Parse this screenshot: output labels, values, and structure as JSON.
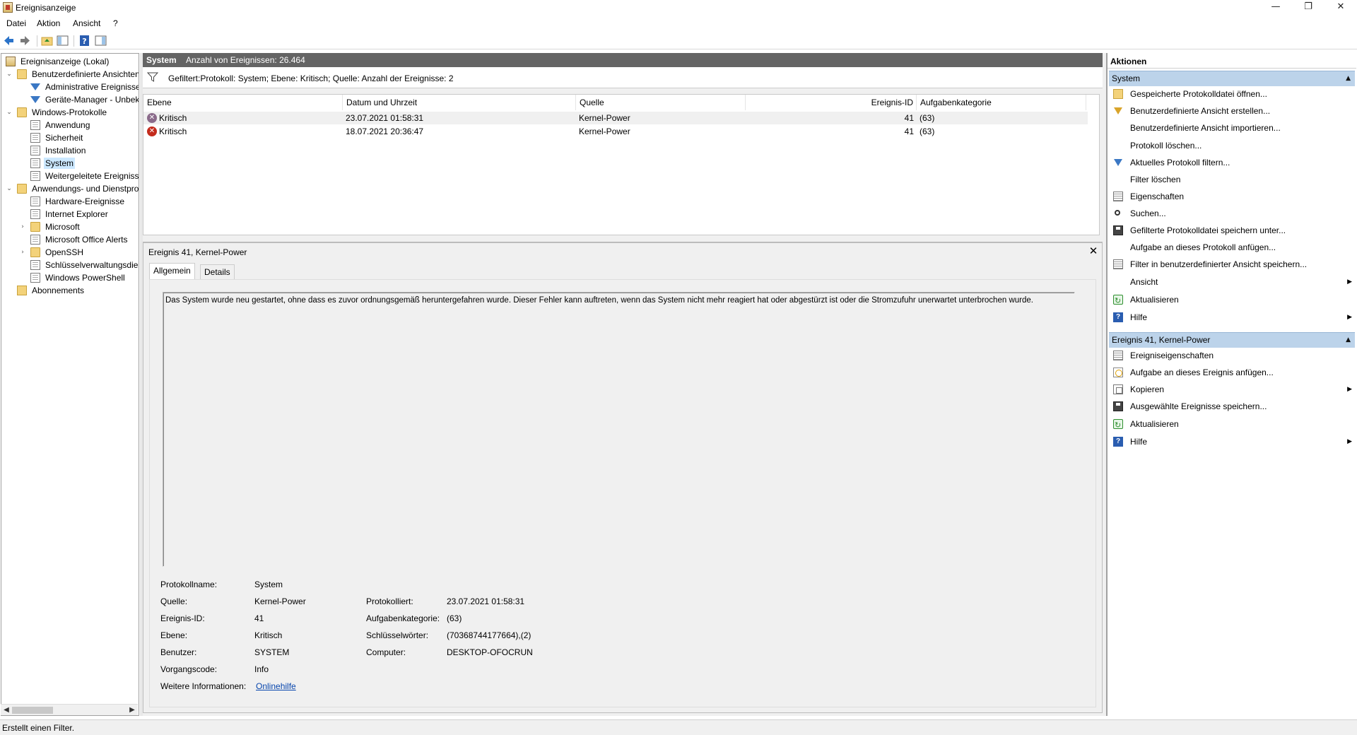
{
  "window": {
    "title": "Ereignisanzeige",
    "minimize_glyph": "—",
    "restore_glyph": "❐",
    "close_glyph": "✕"
  },
  "menu": [
    "Datei",
    "Aktion",
    "Ansicht",
    "?"
  ],
  "tree": {
    "items": [
      {
        "label": "Ereignisanzeige (Lokal)",
        "icon": "event-viewer-icon"
      },
      {
        "label": "Benutzerdefinierte Ansichten",
        "icon": "folder-icon"
      },
      {
        "label": "Administrative Ereignisse",
        "icon": "filter-icon"
      },
      {
        "label": "Geräte-Manager - Unbekannt",
        "icon": "filter-icon"
      },
      {
        "label": "Windows-Protokolle",
        "icon": "folder-icon"
      },
      {
        "label": "Anwendung",
        "icon": "log-icon"
      },
      {
        "label": "Sicherheit",
        "icon": "log-icon"
      },
      {
        "label": "Installation",
        "icon": "log-icon"
      },
      {
        "label": "System",
        "icon": "log-icon"
      },
      {
        "label": "Weitergeleitete Ereignisse",
        "icon": "log-icon"
      },
      {
        "label": "Anwendungs- und Dienstprotokolle",
        "icon": "folder-icon"
      },
      {
        "label": "Hardware-Ereignisse",
        "icon": "log-icon"
      },
      {
        "label": "Internet Explorer",
        "icon": "log-icon"
      },
      {
        "label": "Microsoft",
        "icon": "folder-icon"
      },
      {
        "label": "Microsoft Office Alerts",
        "icon": "log-icon"
      },
      {
        "label": "OpenSSH",
        "icon": "folder-icon"
      },
      {
        "label": "Schlüsselverwaltungsdienst",
        "icon": "log-icon"
      },
      {
        "label": "Windows PowerShell",
        "icon": "log-icon"
      },
      {
        "label": "Abonnements",
        "icon": "subscriptions-icon"
      }
    ]
  },
  "center": {
    "log_name": "System",
    "event_count": "Anzahl von Ereignissen: 26.464",
    "filter_text": "Gefiltert:Protokoll: System; Ebene: Kritisch; Quelle:  Anzahl der Ereignisse: 2",
    "columns": [
      "Ebene",
      "Datum und Uhrzeit",
      "Quelle",
      "Ereignis-ID",
      "Aufgabenkategorie"
    ],
    "rows": [
      {
        "level": "Kritisch",
        "datetime": "23.07.2021 01:58:31",
        "source": "Kernel-Power",
        "event_id": "41",
        "category": "(63)"
      },
      {
        "level": "Kritisch",
        "datetime": "18.07.2021 20:36:47",
        "source": "Kernel-Power",
        "event_id": "41",
        "category": "(63)"
      }
    ]
  },
  "detail": {
    "title": "Ereignis 41, Kernel-Power",
    "close_glyph": "✕",
    "tabs": [
      "Allgemein",
      "Details"
    ],
    "description": "Das System wurde neu gestartet, ohne dass es zuvor ordnungsgemäß heruntergefahren wurde. Dieser Fehler kann auftreten, wenn das System nicht mehr reagiert hat oder abgestürzt ist oder die Stromzufuhr unerwartet unterbrochen wurde.",
    "fields": {
      "protokollname_label": "Protokollname:",
      "protokollname": "System",
      "quelle_label": "Quelle:",
      "quelle": "Kernel-Power",
      "protokolliert_label": "Protokolliert:",
      "protokolliert": "23.07.2021 01:58:31",
      "ereignis_id_label": "Ereignis-ID:",
      "ereignis_id": "41",
      "aufgabenkategorie_label": "Aufgabenkategorie:",
      "aufgabenkategorie": "(63)",
      "ebene_label": "Ebene:",
      "ebene": "Kritisch",
      "schluesselwoerter_label": "Schlüsselwörter:",
      "schluesselwoerter": "(70368744177664),(2)",
      "benutzer_label": "Benutzer:",
      "benutzer": "SYSTEM",
      "computer_label": "Computer:",
      "computer": "DESKTOP-OFOCRUN",
      "vorgangscode_label": "Vorgangscode:",
      "vorgangscode": "Info",
      "weitere_label": "Weitere Informationen:",
      "onlinehilfe": "Onlinehilfe"
    }
  },
  "actions": {
    "header": "Aktionen",
    "section_system": "System",
    "system_items": [
      {
        "label": "Gespeicherte Protokolldatei öffnen...",
        "icon": "folder-open-icon"
      },
      {
        "label": "Benutzerdefinierte Ansicht erstellen...",
        "icon": "create-view-icon"
      },
      {
        "label": "Benutzerdefinierte Ansicht importieren...",
        "icon": ""
      },
      {
        "label": "Protokoll löschen...",
        "icon": ""
      },
      {
        "label": "Aktuelles Protokoll filtern...",
        "icon": "filter-icon"
      },
      {
        "label": "Filter löschen",
        "icon": ""
      },
      {
        "label": "Eigenschaften",
        "icon": "properties-icon"
      },
      {
        "label": "Suchen...",
        "icon": "find-icon"
      },
      {
        "label": "Gefilterte Protokolldatei speichern unter...",
        "icon": "save-icon"
      },
      {
        "label": "Aufgabe an dieses Protokoll anfügen...",
        "icon": ""
      },
      {
        "label": "Filter in benutzerdefinierter Ansicht speichern...",
        "icon": "save-filter-icon"
      },
      {
        "label": "Ansicht",
        "icon": ""
      },
      {
        "label": "Aktualisieren",
        "icon": "refresh-icon"
      },
      {
        "label": "Hilfe",
        "icon": "help-icon"
      }
    ],
    "section_event": "Ereignis 41, Kernel-Power",
    "event_items": [
      {
        "label": "Ereigniseigenschaften",
        "icon": "properties-icon"
      },
      {
        "label": "Aufgabe an dieses Ereignis anfügen...",
        "icon": "task-icon"
      },
      {
        "label": "Kopieren",
        "icon": "copy-icon"
      },
      {
        "label": "Ausgewählte Ereignisse speichern...",
        "icon": "save-icon"
      },
      {
        "label": "Aktualisieren",
        "icon": "refresh-icon"
      },
      {
        "label": "Hilfe",
        "icon": "help-icon"
      }
    ],
    "submenu_glyph": "▶",
    "collapse_glyph": "▲"
  },
  "status": "Erstellt einen Filter."
}
